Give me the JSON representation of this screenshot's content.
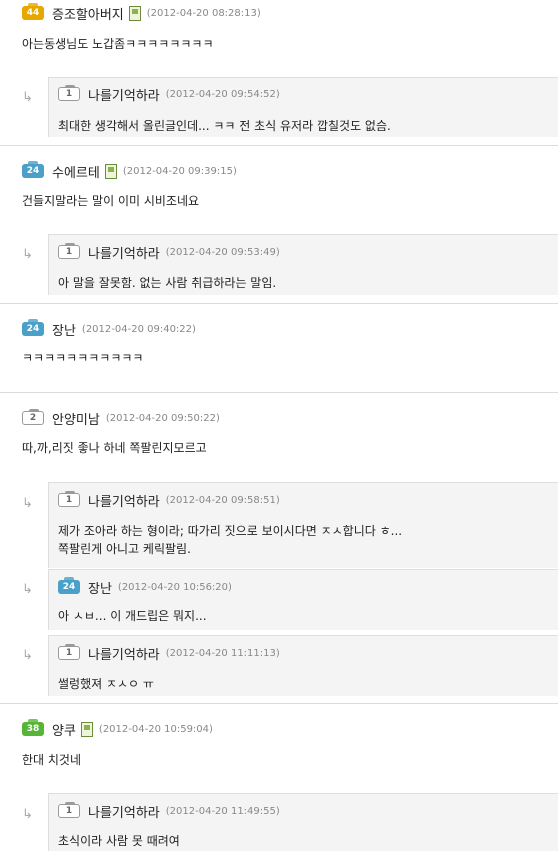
{
  "comments": [
    {
      "level": "44",
      "level_color": "#e6a700",
      "nick": "증조할아버지",
      "date": "(2012-04-20 08:28:13)",
      "mobile": true,
      "text": "아는동생님도 노갑좀ㅋㅋㅋㅋㅋㅋㅋㅋ",
      "replies": [
        {
          "level": "1",
          "nick": "나를기억하라",
          "date": "(2012-04-20 09:54:52)",
          "lines": [
            "최대한 생각해서 올린글인데... ㅋㅋ 전 초식 유저라 깝칠것도 없슴."
          ]
        }
      ]
    },
    {
      "level": "24",
      "level_color": "#4aa0c8",
      "nick": "수에르테",
      "date": "(2012-04-20 09:39:15)",
      "mobile": true,
      "text": "건들지말라는 말이 이미 시비조네요",
      "replies": [
        {
          "level": "1",
          "nick": "나를기억하라",
          "date": "(2012-04-20 09:53:49)",
          "lines": [
            "아 말을 잘못함. 없는 사람  취급하라는 말임."
          ]
        }
      ]
    },
    {
      "level": "24",
      "level_color": "#4aa0c8",
      "nick": "장난",
      "date": "(2012-04-20 09:40:22)",
      "mobile": false,
      "text": "ㅋㅋㅋㅋㅋㅋㅋㅋㅋㅋㅋ",
      "replies": []
    },
    {
      "level": "2",
      "nick": "안양미남",
      "date": "(2012-04-20 09:50:22)",
      "mobile": false,
      "text": "따,까,리짓 좋나 하네 쪽팔린지모르고",
      "replies": [
        {
          "level": "1",
          "nick": "나를기억하라",
          "date": "(2012-04-20 09:58:51)",
          "lines": [
            "제가 조아라 하는 형이라; 따가리 짓으로 보이시다면 ㅈㅅ합니다 ㅎ...",
            "쪽팔린게 아니고 케릭팔림."
          ]
        },
        {
          "level": "24",
          "level_color": "#4aa0c8",
          "nick": "장난",
          "date": "(2012-04-20 10:56:20)",
          "lines": [
            "아 ㅅㅂ... 이 개드립은 뭐지..."
          ]
        },
        {
          "level": "1",
          "nick": "나를기억하라",
          "date": "(2012-04-20 11:11:13)",
          "lines": [
            "썰렁했져 ㅈㅅㅇ ㅠ"
          ]
        }
      ]
    },
    {
      "level": "38",
      "level_color": "#56b536",
      "nick": "양쿠",
      "date": "(2012-04-20 10:59:04)",
      "mobile": true,
      "text": "한대 치것네",
      "replies": [
        {
          "level": "1",
          "nick": "나를기억하라",
          "date": "(2012-04-20 11:49:55)",
          "lines": [
            "초식이라 사람 못 때려여"
          ]
        }
      ]
    }
  ],
  "icons": {
    "reply_arrow": "↳",
    "mobile": "mobile-phone-icon"
  }
}
